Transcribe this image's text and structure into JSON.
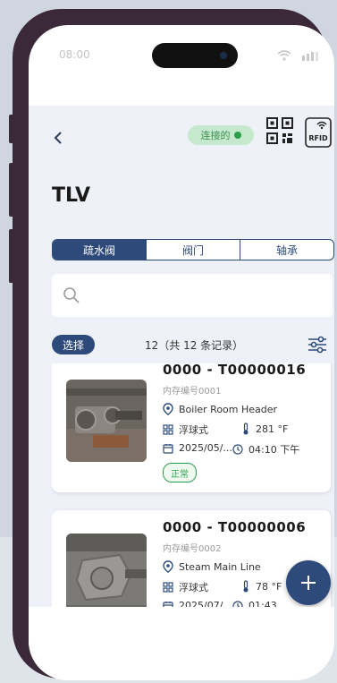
{
  "status_bar": {
    "time": "08:00"
  },
  "header": {
    "back_icon": "chevron-left-icon",
    "connection_label": "连接的",
    "connection_color": "#2e9e4b",
    "qr_icon": "qr-code-icon",
    "rfid_label": "RFID"
  },
  "page": {
    "title": "TLV"
  },
  "tabs": [
    {
      "label": "疏水阀",
      "active": true
    },
    {
      "label": "阀门",
      "active": false
    },
    {
      "label": "轴承",
      "active": false
    }
  ],
  "search": {
    "placeholder": ""
  },
  "toolbar": {
    "select_label": "选择",
    "count_text": "12（共 12 条记录）"
  },
  "items": [
    {
      "id": "0000 - T00000016",
      "inventory": "内存编号0001",
      "location": "Boiler Room Header",
      "type": "浮球式",
      "temperature": "281 °F",
      "date": "2025/05/...",
      "time": "04:10 下午",
      "status": "正常"
    },
    {
      "id": "0000 - T00000006",
      "inventory": "内存编号0002",
      "location": "Steam Main Line",
      "type": "浮球式",
      "temperature": "78 °F",
      "date": "2025/07/...",
      "time": "01:43"
    }
  ],
  "colors": {
    "primary": "#2d4a7a",
    "status_ok": "#2e9e4b",
    "phone_frame": "#3b2838"
  }
}
